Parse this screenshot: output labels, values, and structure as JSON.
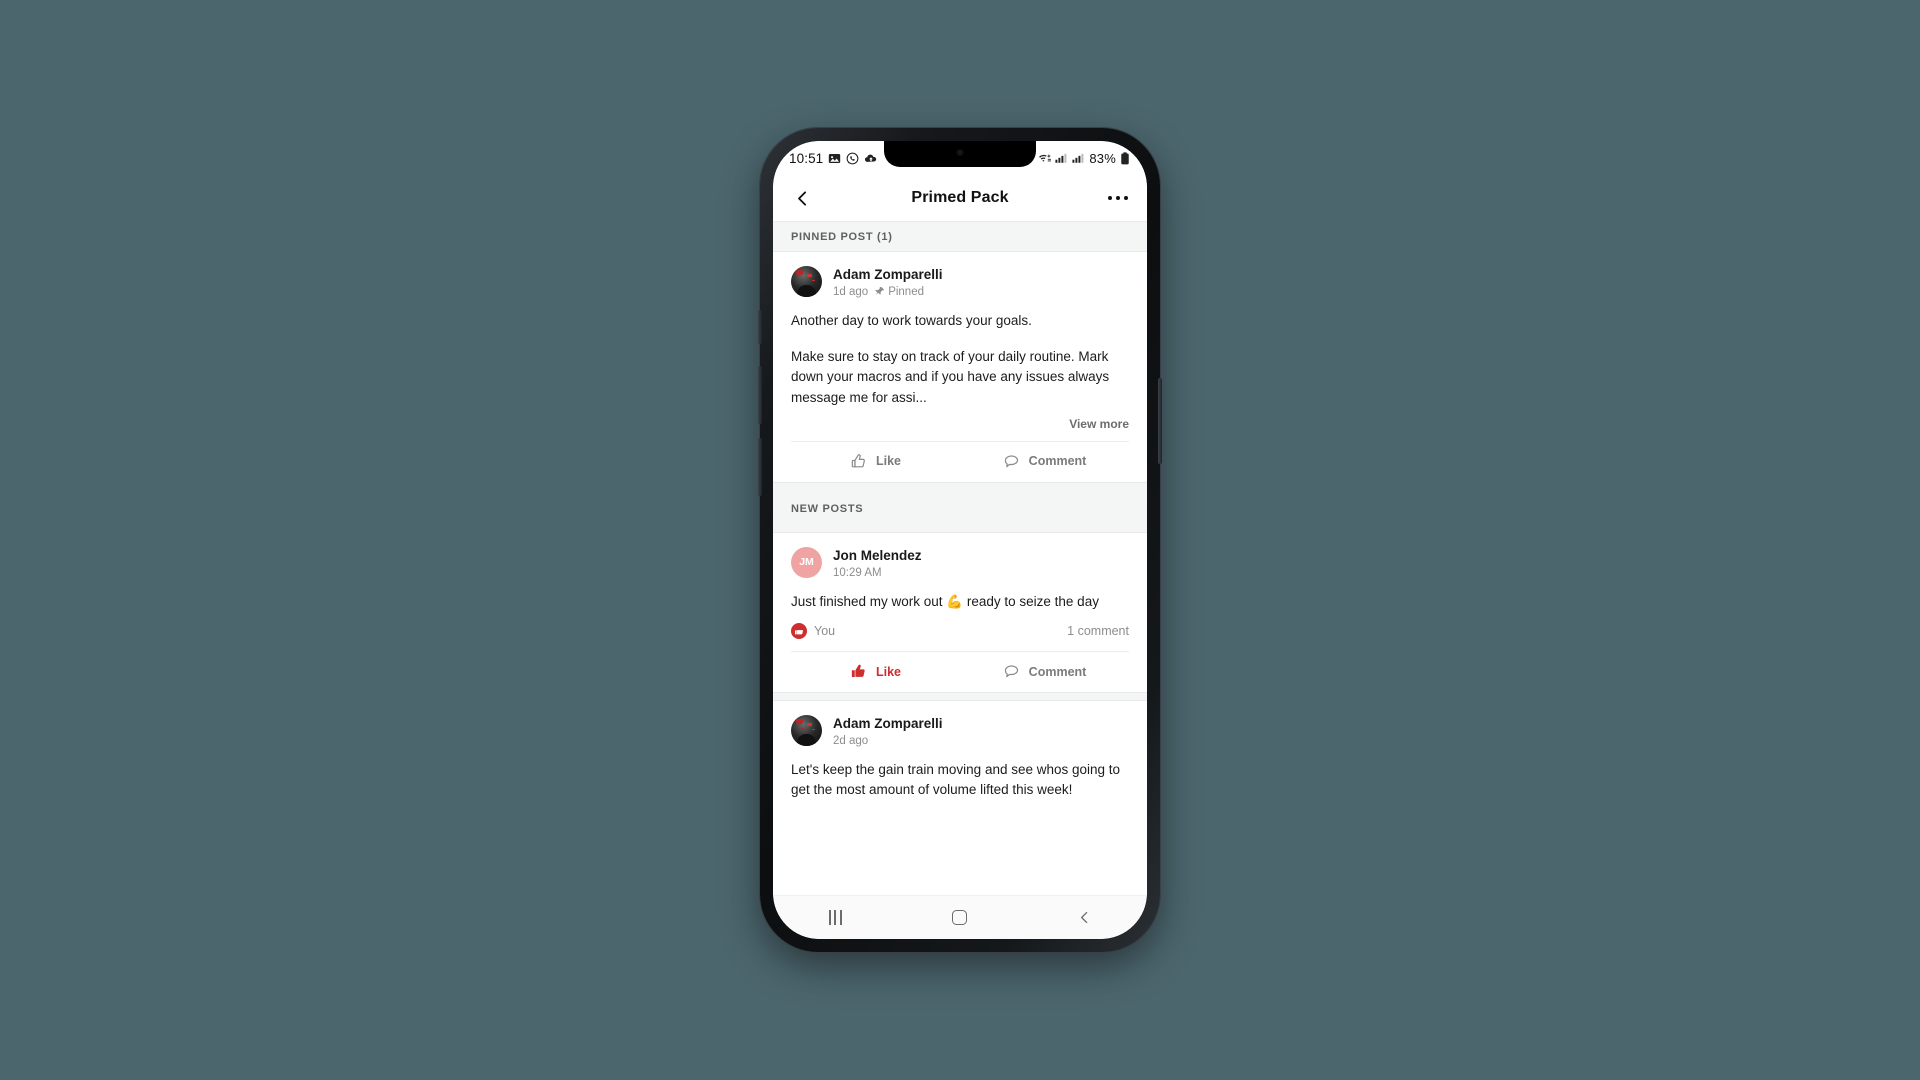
{
  "status_bar": {
    "time": "10:51",
    "left_icons": [
      "photos-icon",
      "whatsapp-icon",
      "upload-cloud-icon"
    ],
    "right_icons": [
      "wifi-calling-icon",
      "signal-bars-sim1-icon",
      "signal-bars-sim2-icon"
    ],
    "battery_text": "83%",
    "battery_icon": "battery-icon"
  },
  "app_bar": {
    "back_icon": "back-chevron-icon",
    "title": "Primed Pack",
    "menu_icon": "overflow-menu-icon"
  },
  "sections": {
    "pinned_label": "PINNED POST (1)",
    "new_posts_label": "NEW POSTS"
  },
  "posts": [
    {
      "avatar_type": "photo",
      "avatar_initials": "",
      "author": "Adam Zomparelli",
      "time": "1d ago",
      "pinned_label": "Pinned",
      "pin_icon": "pin-icon",
      "body_paragraphs": [
        "Another day to work towards your goals.",
        "Make sure to stay on track of your daily routine. Mark down your macros and if you have any issues always message me for assi..."
      ],
      "view_more": "View more",
      "like_label": "Like",
      "comment_label": "Comment",
      "like_icon": "thumbs-up-outline-icon",
      "comment_icon": "comment-bubble-icon",
      "liked": false
    },
    {
      "avatar_type": "initials",
      "avatar_initials": "JM",
      "author": "Jon Melendez",
      "time": "10:29 AM",
      "body_paragraphs": [
        "Just finished my work out 💪 ready to seize the day"
      ],
      "reaction_who": "You",
      "reaction_icon": "thumbs-up-filled-badge-icon",
      "comment_count": "1 comment",
      "like_label": "Like",
      "comment_label": "Comment",
      "like_icon": "thumbs-up-filled-icon",
      "comment_icon": "comment-bubble-icon",
      "liked": true
    },
    {
      "avatar_type": "photo",
      "avatar_initials": "",
      "author": "Adam Zomparelli",
      "time": "2d ago",
      "body_paragraphs": [
        "Let's keep the gain train moving and see whos going to get the most amount of volume lifted this week!"
      ]
    }
  ],
  "nav_bar": {
    "recents_icon": "recents-icon",
    "home_icon": "home-icon",
    "back_icon": "nav-back-icon"
  },
  "colors": {
    "accent_red": "#cf2e2e",
    "avatar_pink": "#f0a3a3",
    "band_gray": "#f4f5f5",
    "backdrop": "#4c666e"
  }
}
